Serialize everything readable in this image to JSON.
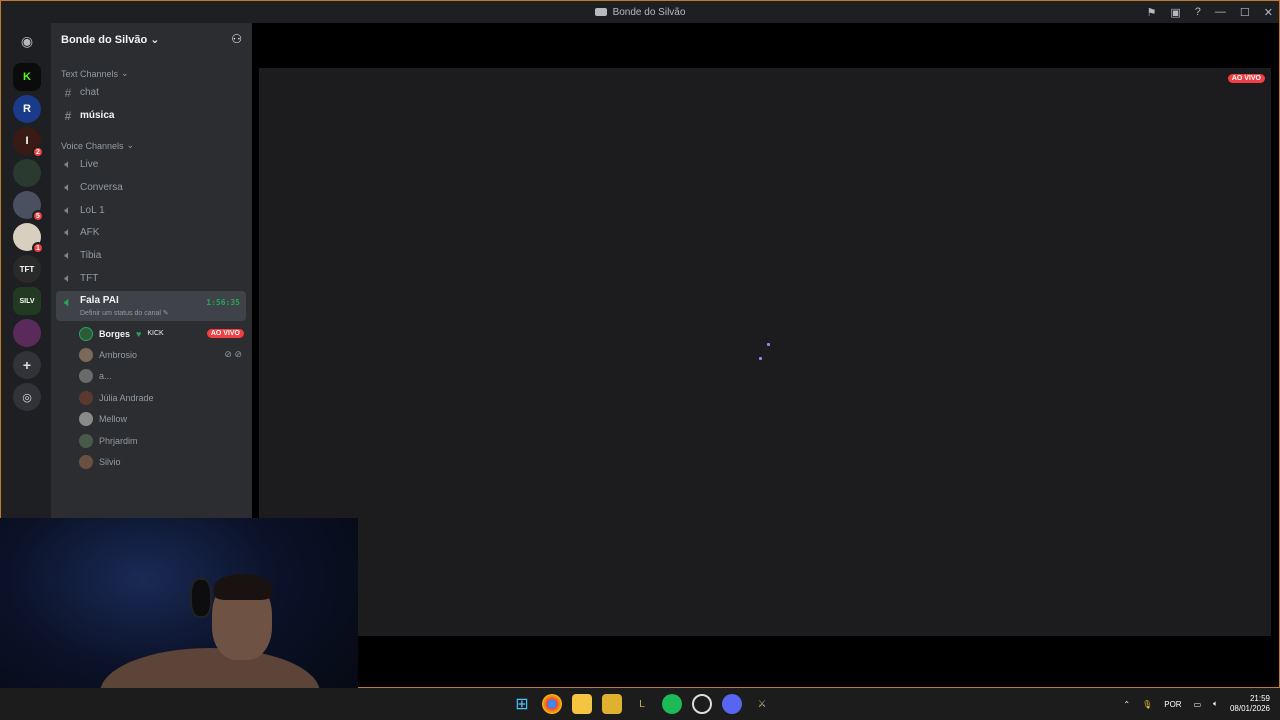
{
  "window": {
    "title": "Bonde do Silvão"
  },
  "titlebar_icons": [
    "flag-icon",
    "inbox-icon",
    "help-icon",
    "minimize-icon",
    "maximize-icon",
    "close-icon"
  ],
  "server": {
    "name": "Bonde do Silvão"
  },
  "guild_badges": {
    "g3": "2",
    "g5": "5",
    "g6": "1"
  },
  "categories": {
    "text": "Text Channels",
    "voice": "Voice Channels"
  },
  "text_channels": [
    "chat",
    "música"
  ],
  "voice_channels": [
    "Live",
    "Conversa",
    "LoL 1",
    "AFK",
    "Tibia",
    "TFT"
  ],
  "active_voice": {
    "name": "Fala PAI",
    "timer": "1:56:35",
    "status": "Definir um status do canal"
  },
  "users": {
    "u0": {
      "name": "Borges",
      "tag": "KICK",
      "live": "AO VIVO"
    },
    "u1": "Ambrosio",
    "u2": "a...",
    "u3": "Júlia Andrade",
    "u4": "Mellow",
    "u5": "Phrjardim",
    "u6": "Silvio"
  },
  "stream": {
    "live_badge": "AO VIVO"
  },
  "tray": {
    "lang": "POR",
    "time": "21:59",
    "date": "08/01/2026"
  },
  "colors": {
    "accent_live": "#f23f43",
    "voice_green": "#23a55a",
    "window_border": "#c17a2b"
  }
}
